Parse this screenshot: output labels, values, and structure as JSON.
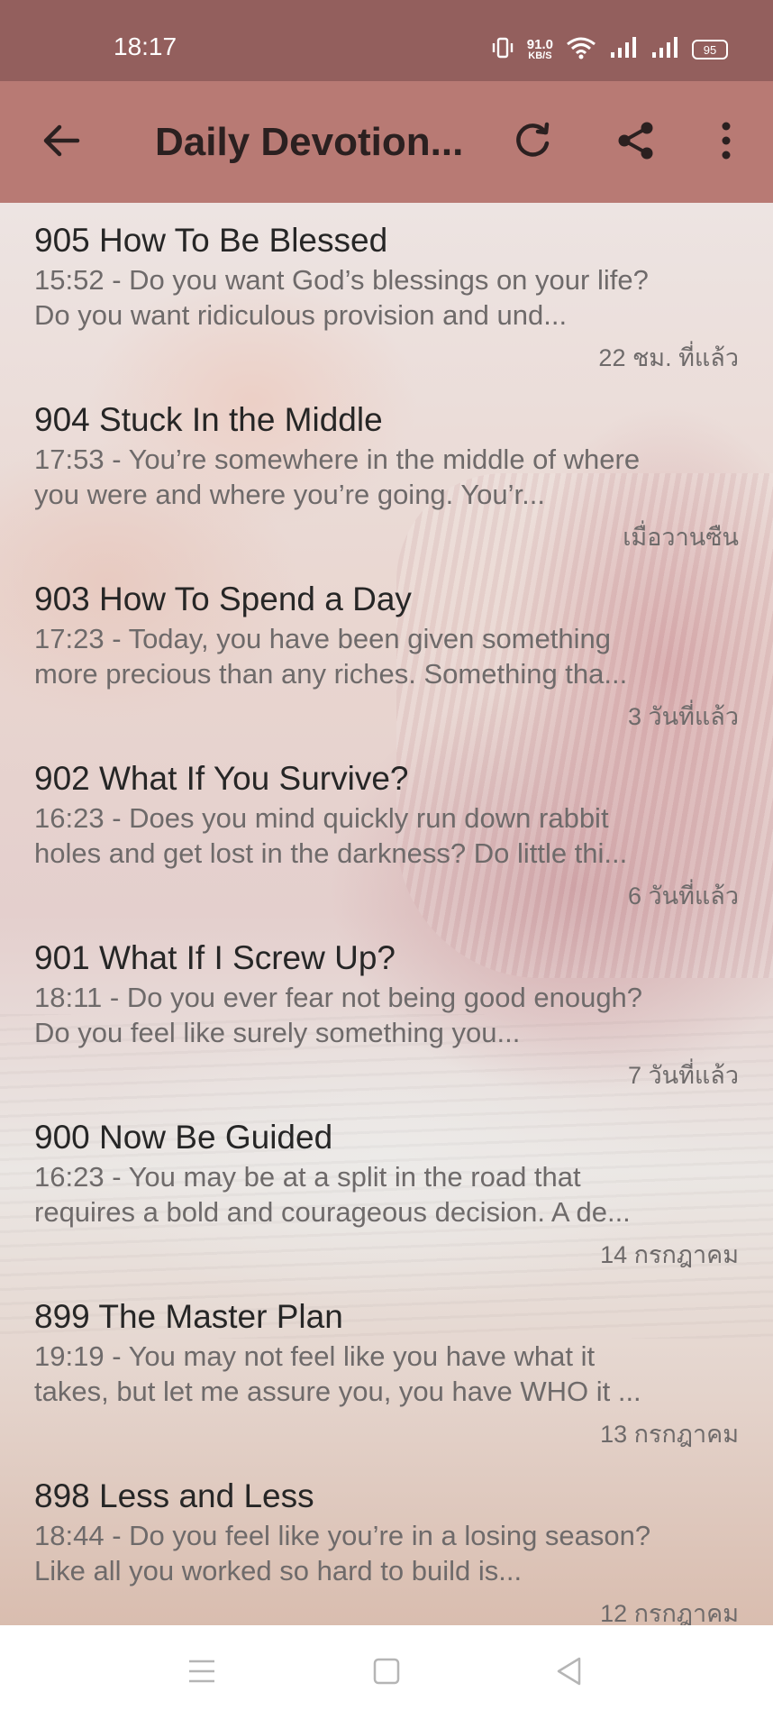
{
  "status_bar": {
    "time": "18:17",
    "net_speed_value": "91.0",
    "net_speed_unit": "KB/S",
    "battery": "95"
  },
  "toolbar": {
    "title": "Daily Devotion..."
  },
  "items": [
    {
      "title": "905 How To Be Blessed",
      "desc": "15:52 - Do you want God’s blessings on your life? Do you want ridiculous provision and und...",
      "meta": "22 ชม. ที่แล้ว"
    },
    {
      "title": "904 Stuck In the Middle",
      "desc": "17:53 - You’re somewhere in the middle of where you were and where you’re going. You’r...",
      "meta": "เมื่อวานซืน"
    },
    {
      "title": "903 How To Spend a Day",
      "desc": "17:23 - Today, you have been given something more precious than any riches. Something tha...",
      "meta": "3 วันที่แล้ว"
    },
    {
      "title": "902 What If You Survive?",
      "desc": "16:23 - Does you mind quickly run down rabbit holes and get lost in the darkness? Do little thi...",
      "meta": "6 วันที่แล้ว"
    },
    {
      "title": "901 What If I Screw Up?",
      "desc": "18:11 - Do you ever fear not being good enough? Do you feel like surely something you...",
      "meta": "7 วันที่แล้ว"
    },
    {
      "title": "900 Now Be Guided",
      "desc": "16:23 - You may be at a split in the road that requires a bold and courageous decision. A de...",
      "meta": "14 กรกฎาคม"
    },
    {
      "title": "899 The Master Plan",
      "desc": "19:19 - You may not feel like you have what it takes, but let me assure you, you have WHO it ...",
      "meta": "13 กรกฎาคม"
    },
    {
      "title": "898 Less and Less",
      "desc": "18:44 - Do you feel like you’re in a losing season? Like all you worked so hard to build is...",
      "meta": "12 กรกฎาคม"
    }
  ],
  "icons": {
    "back": "arrow-left-icon",
    "refresh": "refresh-icon",
    "share": "share-icon",
    "more": "more-vertical-icon"
  },
  "colors": {
    "status_bar": "#935f5d",
    "toolbar": "#b87a74"
  }
}
